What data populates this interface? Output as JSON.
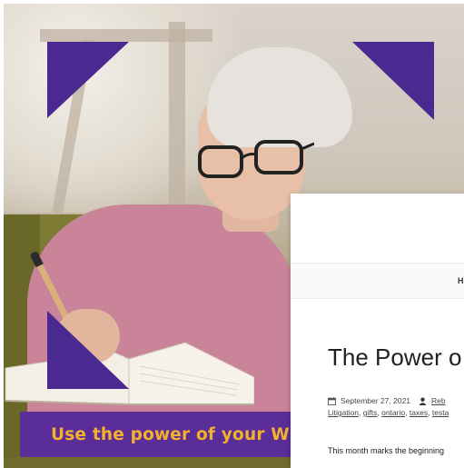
{
  "banner": {
    "text": "Use the power of your W",
    "bg_color": "#5b2d98",
    "text_color": "#f4b12e"
  },
  "blog": {
    "nav_item": "H",
    "post_title": "The Power o",
    "date": "September 27, 2021",
    "author": "Reb",
    "tags": [
      {
        "label": "Litigation"
      },
      {
        "label": "gifts"
      },
      {
        "label": "ontario"
      },
      {
        "label": "taxes"
      },
      {
        "label": "testa"
      }
    ],
    "excerpt": "This month marks the beginning"
  },
  "icons": {
    "calendar": "calendar-icon",
    "user": "user-icon"
  },
  "colors": {
    "accent_purple": "#4a2a91",
    "banner_gold": "#f4b12e"
  }
}
